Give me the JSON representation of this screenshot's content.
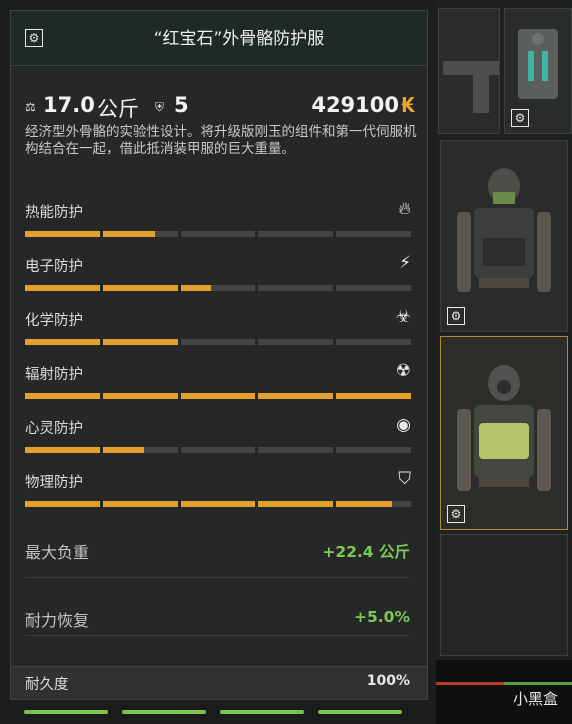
{
  "tooltip": {
    "title": "“红宝石”外骨骼防护服",
    "weight": "17.0",
    "weight_unit": "公斤",
    "armor_class": "5",
    "price": "429100",
    "currency_symbol": "₭",
    "description": "经济型外骨骼的实验性设计。将升级版刚玉的组件和第一代伺服机构结合在一起，借此抵消装甲服的巨大重量。",
    "protections": [
      {
        "label": "热能防护",
        "icon": "fire-icon",
        "level": 0.34
      },
      {
        "label": "电子防护",
        "icon": "lightning-icon",
        "level": 0.48
      },
      {
        "label": "化学防护",
        "icon": "biohazard-icon",
        "level": 0.4
      },
      {
        "label": "辐射防护",
        "icon": "radiation-icon",
        "level": 1.0
      },
      {
        "label": "心灵防护",
        "icon": "psy-icon",
        "level": 0.31
      },
      {
        "label": "物理防护",
        "icon": "shield-icon",
        "level": 0.95
      }
    ],
    "bonuses": [
      {
        "label": "最大负重",
        "value": "+22.4 公斤"
      },
      {
        "label": "耐力恢复",
        "value": "+5.0%"
      }
    ],
    "durability_label": "耐久度",
    "durability_value": "100%"
  },
  "watermark": "小黑盒",
  "colors": {
    "bar_fill": "#e3a02d",
    "bar_empty": "#444645",
    "bonus_green": "#7ec85a",
    "selected_border": "#b08a3a"
  }
}
